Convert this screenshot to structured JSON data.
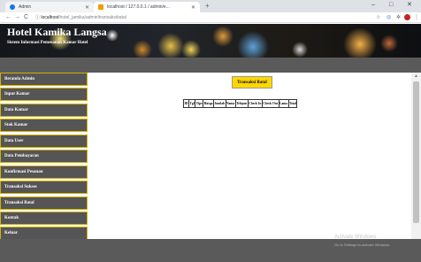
{
  "browser": {
    "tabs": [
      {
        "label": "Admin",
        "active": false
      },
      {
        "label": "localhost / 127.0.0.1 / admin/e...",
        "active": true
      }
    ],
    "new_tab": "+",
    "window_controls": {
      "minimize": "–",
      "maximize": "□",
      "close": "✕"
    },
    "nav": {
      "back": "←",
      "forward": "→",
      "reload": "C"
    },
    "url_host": "localhost",
    "url_path": "/hotel_jamika/admin/transaksibatal"
  },
  "banner": {
    "title": "Hotel Kamika Langsa",
    "subtitle": "Sistem Informasi Pemesanan Kamar Hotel"
  },
  "sidebar": {
    "items": [
      {
        "label": "Beranda Admin"
      },
      {
        "label": "Input Kamar"
      },
      {
        "label": "Data Kamar"
      },
      {
        "label": "Stok Kamar"
      },
      {
        "label": "Data User"
      },
      {
        "label": "Data Pembayaran"
      },
      {
        "label": "Konfirmasi Pesanan"
      },
      {
        "label": "Transaksi Sukses"
      },
      {
        "label": "Transaksi Batal"
      },
      {
        "label": "Kontak"
      },
      {
        "label": "Keluar"
      }
    ]
  },
  "main": {
    "heading_button": "Transaksi Batal",
    "table_headers": [
      "ID",
      "Tgl",
      "Tipe",
      "Harga",
      "Jumlah",
      "Nama",
      "Telepon",
      "Check In",
      "Check Out",
      "Lama",
      "Total"
    ]
  },
  "watermark": {
    "line1": "Activate Windows",
    "line2": "Go to Settings to activate Windows."
  },
  "colors": {
    "nav_bg": "#555555",
    "nav_border": "#d4b106",
    "button_yellow": "#ffd700",
    "bar_grey": "#5a5a5a"
  }
}
